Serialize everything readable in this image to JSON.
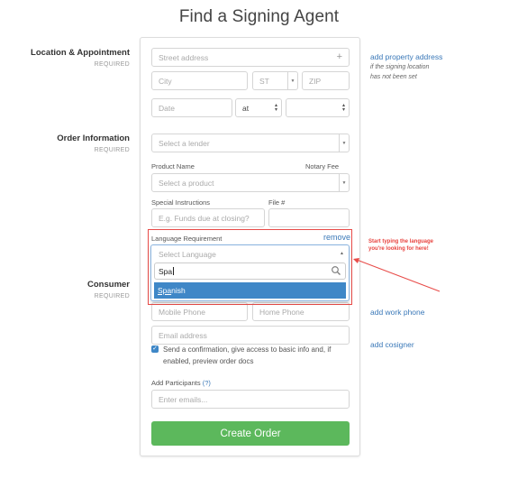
{
  "page": {
    "title": "Find a Signing Agent"
  },
  "colors": {
    "accent": "#3a78b8",
    "primary_button": "#5cb85c",
    "highlight": "#e84b48",
    "selected_option": "#3f87c7"
  },
  "sections": {
    "location": {
      "title": "Location & Appointment",
      "required": "REQUIRED"
    },
    "order": {
      "title": "Order Information",
      "required": "REQUIRED"
    },
    "consumer": {
      "title": "Consumer",
      "required": "REQUIRED"
    }
  },
  "location": {
    "street_placeholder": "Street address",
    "street_icon": "plus-icon",
    "city_placeholder": "City",
    "state_placeholder": "ST",
    "zip_placeholder": "ZIP",
    "date_placeholder": "Date",
    "at_value": "at",
    "time_value": ""
  },
  "side": {
    "add_property_address": "add property address",
    "property_note_line1": "if the signing location",
    "property_note_line2": "has not been set",
    "add_work_phone": "add work phone",
    "add_cosigner": "add cosigner"
  },
  "order": {
    "lender_placeholder": "Select a lender",
    "product_label": "Product Name",
    "notary_fee_label": "Notary Fee",
    "product_placeholder": "Select a product",
    "special_instructions_label": "Special Instructions",
    "special_instructions_placeholder": "E.g. Funds due at closing?",
    "file_label": "File #",
    "file_value": ""
  },
  "language": {
    "label": "Language Requirement",
    "remove": "remove",
    "placeholder": "Select Language",
    "search_value": "Spa",
    "search_icon": "search-icon",
    "options": [
      {
        "match": "Spa",
        "rest": "nish",
        "selected": true
      }
    ]
  },
  "consumer": {
    "mobile_placeholder": "Mobile Phone",
    "home_placeholder": "Home Phone",
    "email_placeholder": "Email address",
    "confirmation_checked": true,
    "confirmation_text": "Send a confirmation, give access to basic info and, if enabled, preview order docs"
  },
  "participants": {
    "label": "Add Participants",
    "help": "(?)",
    "placeholder": "Enter emails..."
  },
  "actions": {
    "create_order": "Create Order"
  },
  "annotation": {
    "line1": "Start typing the language",
    "line2": "you're looking for here!"
  }
}
